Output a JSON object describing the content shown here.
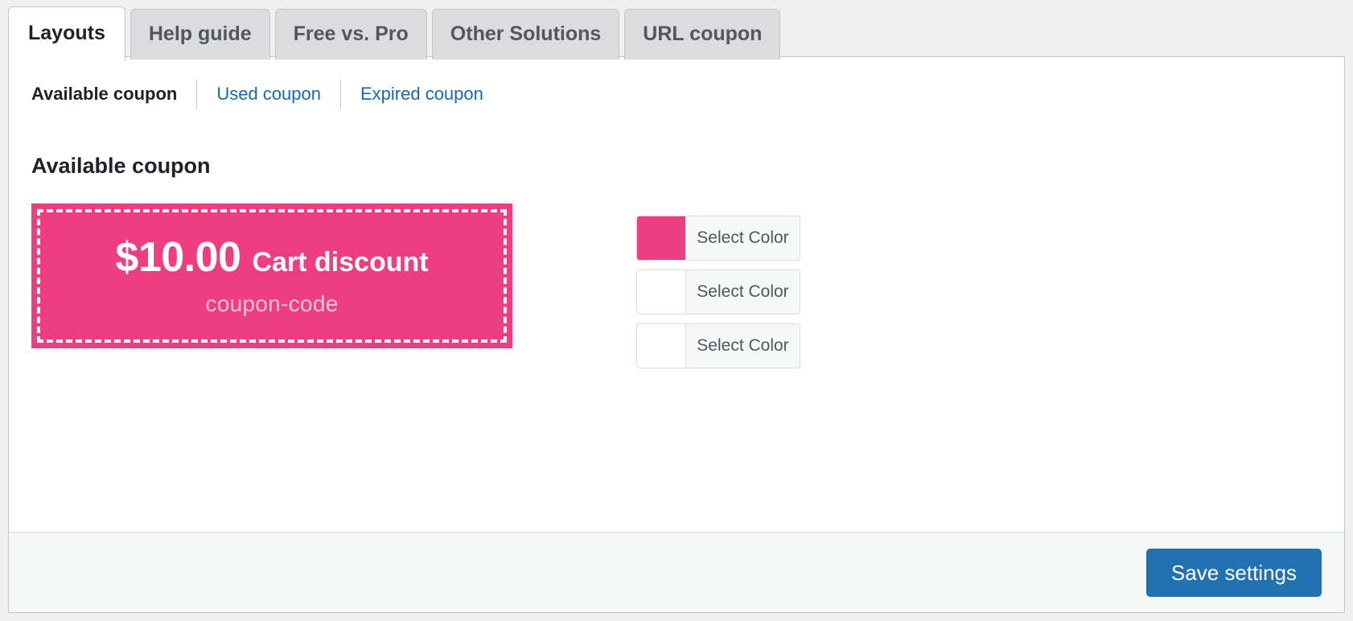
{
  "tabs": [
    {
      "label": "Layouts",
      "active": true
    },
    {
      "label": "Help guide",
      "active": false
    },
    {
      "label": "Free vs. Pro",
      "active": false
    },
    {
      "label": "Other Solutions",
      "active": false
    },
    {
      "label": "URL coupon",
      "active": false
    }
  ],
  "subnav": [
    {
      "label": "Available coupon",
      "current": true
    },
    {
      "label": "Used coupon",
      "current": false
    },
    {
      "label": "Expired coupon",
      "current": false
    }
  ],
  "section": {
    "title": "Available coupon"
  },
  "coupon": {
    "amount": "$10.00",
    "type_label": "Cart discount",
    "code": "coupon-code",
    "background_color": "#ee3d80",
    "dash_border_color": "#ffffff",
    "code_color": "#ffc3da"
  },
  "color_pickers": [
    {
      "label": "Select Color",
      "swatch_color": "#ee3d80"
    },
    {
      "label": "Select Color",
      "swatch_color": "#ffffff"
    },
    {
      "label": "Select Color",
      "swatch_color": "#ffffff"
    }
  ],
  "footer": {
    "save_label": "Save settings",
    "save_color": "#2271b1"
  }
}
